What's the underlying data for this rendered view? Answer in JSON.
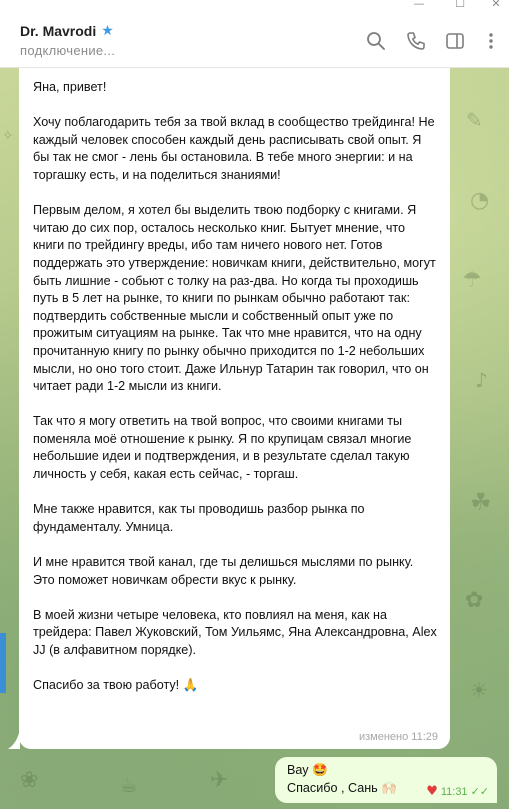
{
  "window": {
    "minimize_glyph": "—",
    "maximize_glyph": "☐",
    "close_glyph": "✕"
  },
  "header": {
    "title": "Dr. Mavrodi",
    "verified_glyph": "★",
    "status": "подключение..."
  },
  "icons": [
    "search-icon",
    "phone-icon",
    "sidebar-toggle-icon",
    "more-icon"
  ],
  "message_in": {
    "paragraphs": [
      "Яна, привет!",
      "Хочу поблагодарить тебя за твой вклад в сообщество трейдинга! Не каждый человек способен каждый день расписывать свой опыт. Я бы так не смог - лень бы остановила. В тебе много энергии: и на торгашку есть, и на поделиться знаниями!",
      "Первым делом, я хотел бы выделить твою подборку с книгами. Я читаю до сих пор, осталось несколько книг. Бытует мнение, что книги по трейдингу вреды, ибо там ничего нового нет. Готов поддержать это утверждение: новичкам книги, действительно, могут быть лишние - собьют с толку на раз-два. Но когда ты проходишь путь в 5 лет на рынке, то книги по рынкам обычно работают так: подтвердить собственные мысли и собственный опыт уже по прожитым ситуациям на рынке. Так что мне нравится, что на одну прочитанную книгу по рынку обычно приходится по 1-2 небольших мысли, но оно того стоит. Даже Ильнур Татарин так говорил, что он читает ради 1-2 мысли из книги.",
      "Так что я могу ответить на твой вопрос, что своими книгами ты поменяла моё отношение к рынку. Я по крупицам связал многие небольшие идеи и подтверждения, и в результате сделал такую личность у себя, какая есть сейчас, - торгаш.",
      "Мне также нравится, как ты проводишь разбор рынка по фундаменталу. Умница.",
      "И мне нравится твой канал, где ты делишься мыслями по рынку. Это поможет новичкам обрести вкус к рынку.",
      "В моей жизни четыре человека, кто повлиял на меня, как на трейдера: Павел Жуковский, Том Уильямс, Яна Александровна, Alex JJ (в алфавитном порядке).",
      "Спасибо за твою работу! 🙏"
    ],
    "edited_label": "изменено 11:29"
  },
  "message_out": {
    "line1": "Вау 🤩",
    "line2": "Спасибо , Сань 🙌🏻",
    "reaction": "♥",
    "time": "11:31",
    "read_glyph": "✓✓"
  },
  "colors": {
    "accent": "#3c9be6",
    "outgoing_bubble": "#eefedf",
    "read_check": "#5eb24d",
    "reaction_heart": "#e23b3b"
  }
}
